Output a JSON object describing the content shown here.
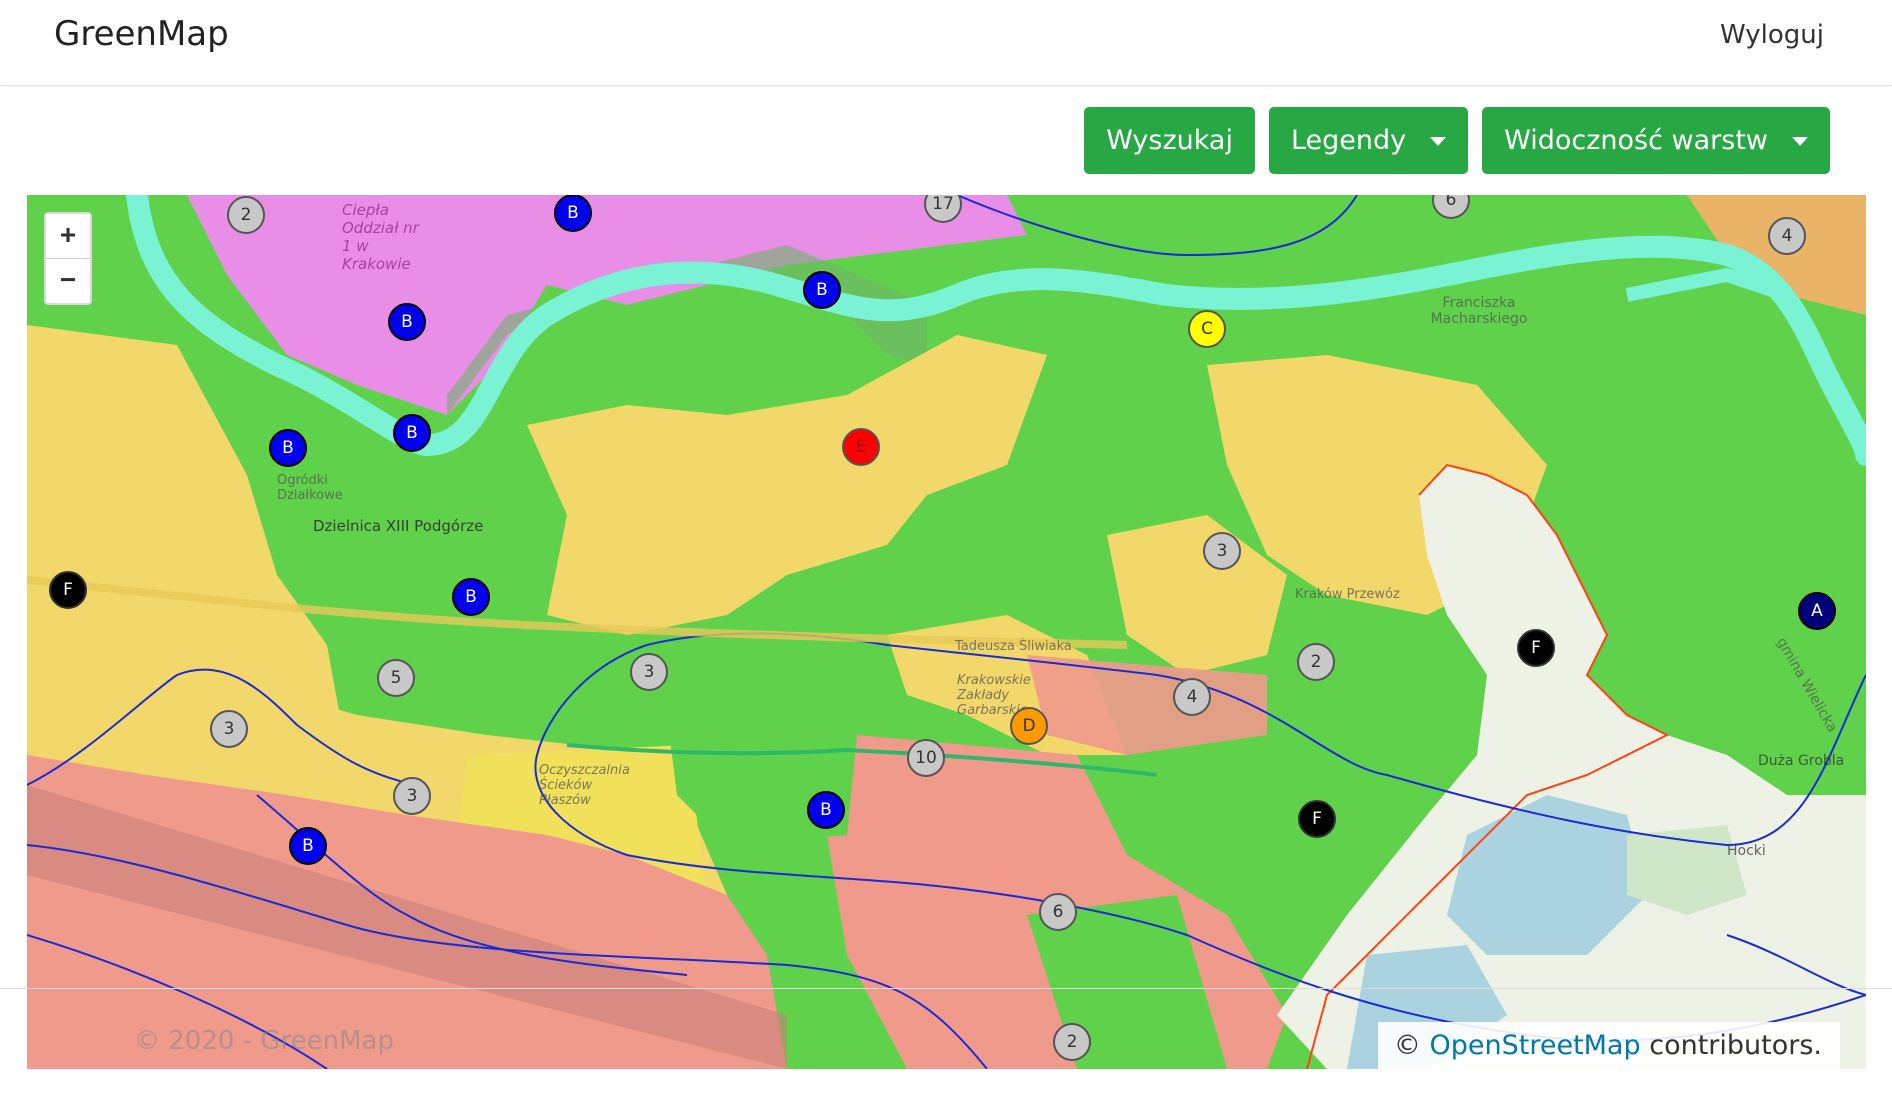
{
  "navbar": {
    "brand": "GreenMap",
    "logout": "Wyloguj"
  },
  "toolbar": {
    "search_label": "Wyszukaj",
    "legends_label": "Legendy",
    "layers_label": "Widoczność warstw"
  },
  "zoom": {
    "in": "+",
    "out": "−"
  },
  "map_labels": [
    {
      "text": "Dzielnica XIII Podgórze"
    },
    {
      "text": "Ciepła Oddział nr 1 w Krakowie"
    },
    {
      "text": "Ogródki Działkowe"
    },
    {
      "text": "Tadeusza Śliwiaka"
    },
    {
      "text": "Krakowskie Zakłady Garbarskie"
    },
    {
      "text": "Oczyszczalnia Ścieków Płaszów"
    },
    {
      "text": "Duża Grobla"
    },
    {
      "text": "Hocki"
    },
    {
      "text": "gmina Wielicka"
    },
    {
      "text": "Kraków Przewóz"
    },
    {
      "text": "Franciszka Macharskiego"
    }
  ],
  "markers": [
    {
      "label": "2",
      "kind": "cluster"
    },
    {
      "label": "B",
      "kind": "B"
    },
    {
      "label": "17",
      "kind": "cluster"
    },
    {
      "label": "6",
      "kind": "cluster"
    },
    {
      "label": "4",
      "kind": "cluster"
    },
    {
      "label": "B",
      "kind": "B"
    },
    {
      "label": "B",
      "kind": "B"
    },
    {
      "label": "C",
      "kind": "C"
    },
    {
      "label": "B",
      "kind": "B"
    },
    {
      "label": "B",
      "kind": "B"
    },
    {
      "label": "E",
      "kind": "E"
    },
    {
      "label": "3",
      "kind": "cluster"
    },
    {
      "label": "F",
      "kind": "F"
    },
    {
      "label": "B",
      "kind": "B"
    },
    {
      "label": "A",
      "kind": "A"
    },
    {
      "label": "F",
      "kind": "F"
    },
    {
      "label": "3",
      "kind": "cluster"
    },
    {
      "label": "2",
      "kind": "cluster"
    },
    {
      "label": "5",
      "kind": "cluster"
    },
    {
      "label": "4",
      "kind": "cluster"
    },
    {
      "label": "D",
      "kind": "D"
    },
    {
      "label": "3",
      "kind": "cluster"
    },
    {
      "label": "10",
      "kind": "cluster"
    },
    {
      "label": "3",
      "kind": "cluster"
    },
    {
      "label": "B",
      "kind": "B"
    },
    {
      "label": "F",
      "kind": "F"
    },
    {
      "label": "B",
      "kind": "B"
    },
    {
      "label": "6",
      "kind": "cluster"
    },
    {
      "label": "2",
      "kind": "cluster"
    }
  ],
  "marker_styles": {
    "cluster": {
      "bg": "#c8c8c8",
      "fg": "#333333",
      "border": "#555555"
    },
    "A": {
      "bg": "#00007a",
      "fg": "#ffffff",
      "border": "#000000"
    },
    "B": {
      "bg": "#0000ee",
      "fg": "#ffffff",
      "border": "#000000"
    },
    "C": {
      "bg": "#ffff00",
      "fg": "#333333",
      "border": "#555555"
    },
    "D": {
      "bg": "#ff9900",
      "fg": "#333333",
      "border": "#555555"
    },
    "E": {
      "bg": "#ff0000",
      "fg": "#a00000",
      "border": "#555555"
    },
    "F": {
      "bg": "#000000",
      "fg": "#ffffff",
      "border": "#333333"
    }
  },
  "colors": {
    "accent": "#28a745",
    "zone_green": "#5fd14a",
    "zone_yellow": "#f2d86b",
    "zone_pink": "#e98ee6",
    "zone_red": "#f09a8c",
    "river": "#7af2d4",
    "boundary": "#ff4411"
  },
  "footer": {
    "copyright": "© 2020 - GreenMap"
  },
  "attribution": {
    "prefix": "©",
    "link": "OpenStreetMap",
    "suffix": "contributors."
  }
}
